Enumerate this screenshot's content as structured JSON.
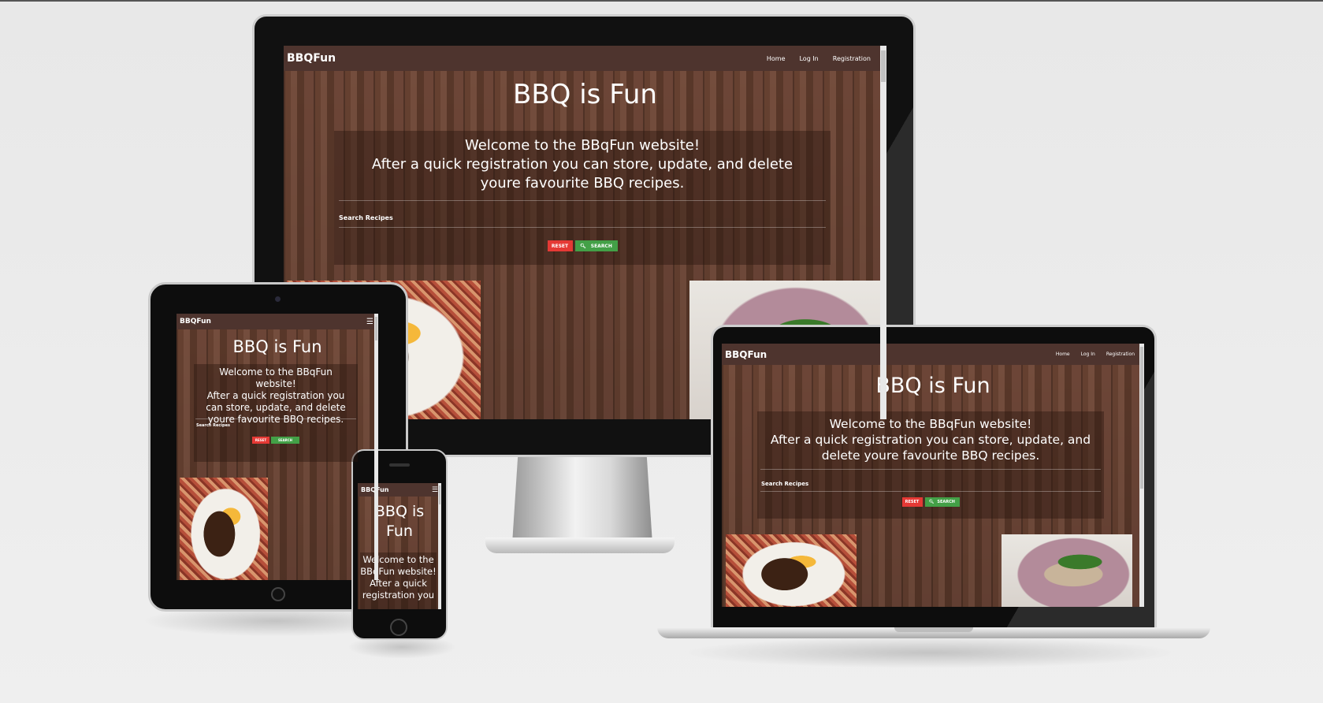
{
  "site": {
    "brand": "BBQFun",
    "nav_links": [
      "Home",
      "Log In",
      "Registration"
    ],
    "hero_title": "BBQ is Fun",
    "welcome_line1": "Welcome to the BBqFun website!",
    "welcome_line2": "After a quick registration you can store, update, and delete youre favourite BBQ recipes.",
    "search_label": "Search Recipes",
    "reset_label": "RESET",
    "search_button_label": "SEARCH",
    "menu_icon": "hamburger-icon",
    "search_icon": "magnifier-icon"
  },
  "phone": {
    "hero_line1": "BBQ is",
    "hero_line2": "Fun",
    "welcome_lines": [
      "Welcome to the",
      "BBqFun website!",
      "After a quick",
      "registration you"
    ]
  },
  "colors": {
    "navbar": "#4e342e",
    "reset_button": "#e53935",
    "search_button": "#43a047",
    "background": "#ececec"
  }
}
